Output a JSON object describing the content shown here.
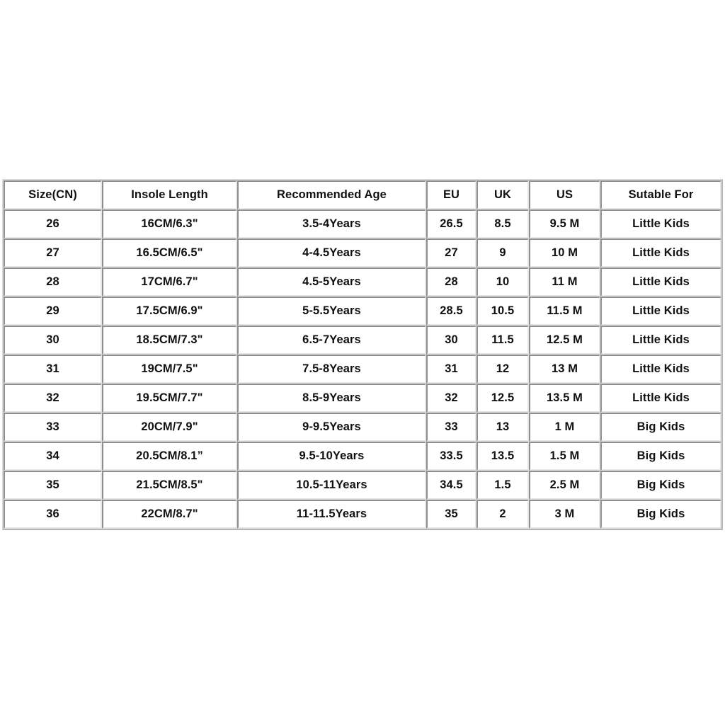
{
  "page": {
    "background_color": "#ffffff",
    "text_color": "#111111",
    "border_color": "#8e8e8e"
  },
  "table": {
    "name": "kids-shoe-size-chart",
    "columns": [
      {
        "key": "size_cn",
        "label": "Size(CN)"
      },
      {
        "key": "insole_length",
        "label": "Insole Length"
      },
      {
        "key": "recommended_age",
        "label": "Recommended Age"
      },
      {
        "key": "eu",
        "label": "EU"
      },
      {
        "key": "uk",
        "label": "UK"
      },
      {
        "key": "us",
        "label": "US"
      },
      {
        "key": "suitable_for",
        "label": "Sutable For"
      }
    ],
    "rows": [
      {
        "size_cn": "26",
        "insole_length": "16CM/6.3\"",
        "recommended_age": "3.5-4Years",
        "eu": "26.5",
        "uk": "8.5",
        "us": "9.5 M",
        "suitable_for": "Little Kids"
      },
      {
        "size_cn": "27",
        "insole_length": "16.5CM/6.5\"",
        "recommended_age": "4-4.5Years",
        "eu": "27",
        "uk": "9",
        "us": "10 M",
        "suitable_for": "Little Kids"
      },
      {
        "size_cn": "28",
        "insole_length": "17CM/6.7\"",
        "recommended_age": "4.5-5Years",
        "eu": "28",
        "uk": "10",
        "us": "11 M",
        "suitable_for": "Little Kids"
      },
      {
        "size_cn": "29",
        "insole_length": "17.5CM/6.9\"",
        "recommended_age": "5-5.5Years",
        "eu": "28.5",
        "uk": "10.5",
        "us": "11.5 M",
        "suitable_for": "Little Kids"
      },
      {
        "size_cn": "30",
        "insole_length": "18.5CM/7.3\"",
        "recommended_age": "6.5-7Years",
        "eu": "30",
        "uk": "11.5",
        "us": "12.5 M",
        "suitable_for": "Little Kids"
      },
      {
        "size_cn": "31",
        "insole_length": "19CM/7.5\"",
        "recommended_age": "7.5-8Years",
        "eu": "31",
        "uk": "12",
        "us": "13 M",
        "suitable_for": "Little Kids"
      },
      {
        "size_cn": "32",
        "insole_length": "19.5CM/7.7\"",
        "recommended_age": "8.5-9Years",
        "eu": "32",
        "uk": "12.5",
        "us": "13.5 M",
        "suitable_for": "Little Kids"
      },
      {
        "size_cn": "33",
        "insole_length": "20CM/7.9\"",
        "recommended_age": "9-9.5Years",
        "eu": "33",
        "uk": "13",
        "us": "1 M",
        "suitable_for": "Big Kids"
      },
      {
        "size_cn": "34",
        "insole_length": "20.5CM/8.1”",
        "recommended_age": "9.5-10Years",
        "eu": "33.5",
        "uk": "13.5",
        "us": "1.5 M",
        "suitable_for": "Big Kids"
      },
      {
        "size_cn": "35",
        "insole_length": "21.5CM/8.5\"",
        "recommended_age": "10.5-11Years",
        "eu": "34.5",
        "uk": "1.5",
        "us": "2.5 M",
        "suitable_for": "Big Kids"
      },
      {
        "size_cn": "36",
        "insole_length": "22CM/8.7\"",
        "recommended_age": "11-11.5Years",
        "eu": "35",
        "uk": "2",
        "us": "3 M",
        "suitable_for": "Big Kids"
      }
    ]
  }
}
